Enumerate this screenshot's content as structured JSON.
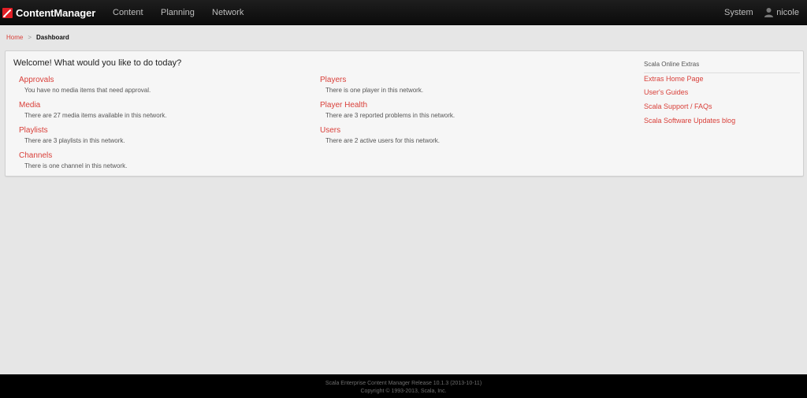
{
  "app": {
    "logo_text": "ContentManager",
    "nav": [
      "Content",
      "Planning",
      "Network"
    ],
    "system_label": "System",
    "username": "nicole"
  },
  "breadcrumb": {
    "home": "Home",
    "separator": ">",
    "current": "Dashboard"
  },
  "dashboard": {
    "welcome": "Welcome! What would you like to do today?",
    "items": [
      {
        "title": "Approvals",
        "desc": "You have no media items that need approval."
      },
      {
        "title": "Media",
        "desc": "There are 27 media items available in this network."
      },
      {
        "title": "Playlists",
        "desc": "There are 3 playlists in this network."
      },
      {
        "title": "Channels",
        "desc": "There is one channel in this network."
      },
      {
        "title": "Players",
        "desc": "There is one player in this network."
      },
      {
        "title": "Player Health",
        "desc": "There are 3 reported problems in this network."
      },
      {
        "title": "Users",
        "desc": "There are 2 active users for this network."
      }
    ]
  },
  "extras": {
    "heading": "Scala Online Extras",
    "links": [
      "Extras Home Page",
      "User's Guides",
      "Scala Support / FAQs",
      "Scala Software Updates blog"
    ]
  },
  "footer": {
    "release": "Scala Enterprise Content Manager Release 10.1.3 (2013-10-11)",
    "copyright": "Copyright © 1993-2013, Scala, Inc."
  },
  "colors": {
    "accent": "#d9403a",
    "brand_red": "#e21f26",
    "topbar": "#111111",
    "background": "#e6e6e6"
  },
  "icons": {
    "logo": "scala-logo-icon",
    "user": "user-icon"
  }
}
